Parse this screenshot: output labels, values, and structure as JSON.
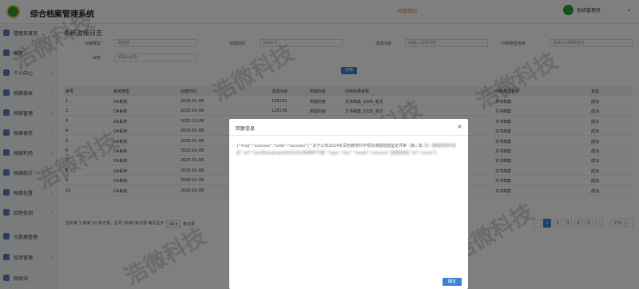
{
  "header": {
    "title": "综合档案管理系统",
    "center_link": "档案借阅",
    "user": "系统管理员"
  },
  "sidebar": {
    "items": [
      {
        "label": "管理员首页",
        "chev": ""
      },
      {
        "label": "首页",
        "chev": ""
      },
      {
        "label": "个人中心",
        "chev": "‹"
      },
      {
        "label": "档案接收",
        "chev": "‹"
      },
      {
        "label": "档案管理",
        "chev": "‹"
      },
      {
        "label": "档案保存",
        "chev": "‹"
      },
      {
        "label": "档案利用",
        "chev": "‹"
      },
      {
        "label": "档案统计",
        "chev": "‹"
      },
      {
        "label": "档案处置",
        "chev": "‹"
      },
      {
        "label": "四性检测",
        "chev": "‹"
      },
      {
        "label": "元数据管理",
        "chev": ""
      },
      {
        "label": "库房管理",
        "chev": "‹"
      },
      {
        "label": "回收站",
        "chev": ""
      }
    ]
  },
  "main": {
    "page_title": "系统对接日志",
    "filters": {
      "type_label": "对接类型",
      "type_value": "请选择",
      "time_label": "创建时间",
      "time_value": "1900-1-",
      "request_label": "请求内容",
      "request_placeholder": "请输入请求内容",
      "category_label": "归档类型名称",
      "category_placeholder": "请输入归档类型名",
      "status_label": "状态",
      "status_placeholder": "请输入状态",
      "search_label": "搜索"
    },
    "table": {
      "headers": [
        "序号",
        "系统类型",
        "创建时间",
        "请求内容",
        "附加内容",
        "归档目录名称",
        "归档类型名称",
        "状态"
      ],
      "rows": [
        [
          "1",
          "OA系统",
          "2025-01-08",
          "125152",
          "附加内容",
          "文书档案_2025_收文",
          "文书档案",
          "成功"
        ],
        [
          "2",
          "OA系统",
          "2025-01-08",
          "125178",
          "附加内容",
          "文书档案_2025_收文",
          "文书档案",
          "成功"
        ],
        [
          "3",
          "OA系统",
          "2025-01-08",
          "",
          "",
          "",
          "文书档案",
          "成功"
        ],
        [
          "4",
          "OA系统",
          "2025-01-08",
          "",
          "",
          "",
          "文书档案",
          "成功"
        ],
        [
          "5",
          "OA系统",
          "2025-01-08",
          "",
          "",
          "",
          "文书档案",
          "成功"
        ],
        [
          "6",
          "OA系统",
          "2025-01-08",
          "",
          "",
          "",
          "文书档案",
          "成功"
        ],
        [
          "7",
          "OA系统",
          "2025-01-08",
          "",
          "",
          "",
          "文书档案",
          "成功"
        ],
        [
          "8",
          "OA系统",
          "2025-01-08",
          "",
          "",
          "",
          "文书档案",
          "成功"
        ],
        [
          "9",
          "OA系统",
          "2025-01-08",
          "",
          "",
          "",
          "文书档案",
          "成功"
        ],
        [
          "10",
          "OA系统",
          "2025-01-08",
          "",
          "",
          "",
          "文书档案",
          "成功"
        ]
      ]
    },
    "pager": {
      "info": "显示第 1 到第 10 条记录，总共 1698 条记录 每页显示",
      "page_size": "10 ▾",
      "unit": "条记录",
      "pages": [
        "‹",
        "1",
        "2",
        "3",
        "4",
        "5",
        "...",
        "170",
        "›"
      ]
    }
  },
  "modal": {
    "title": "回复信息",
    "close": "×",
    "text_visible": "{\"msg\":\"success\",\"code\":\"success\"}\" 关于公布2024年百色教育科学规划课题结题鉴定评审（第二批",
    "text_blurred": "次）通知的附件信息 \"url\":\"/profile/upload/2025/01/08/附件下载\" \"type\":\"doc\" \"result\":\"success\" [回复信息] \"id\":\"sysno\"}",
    "ok_label": "确定"
  },
  "watermark": "浩微科技"
}
